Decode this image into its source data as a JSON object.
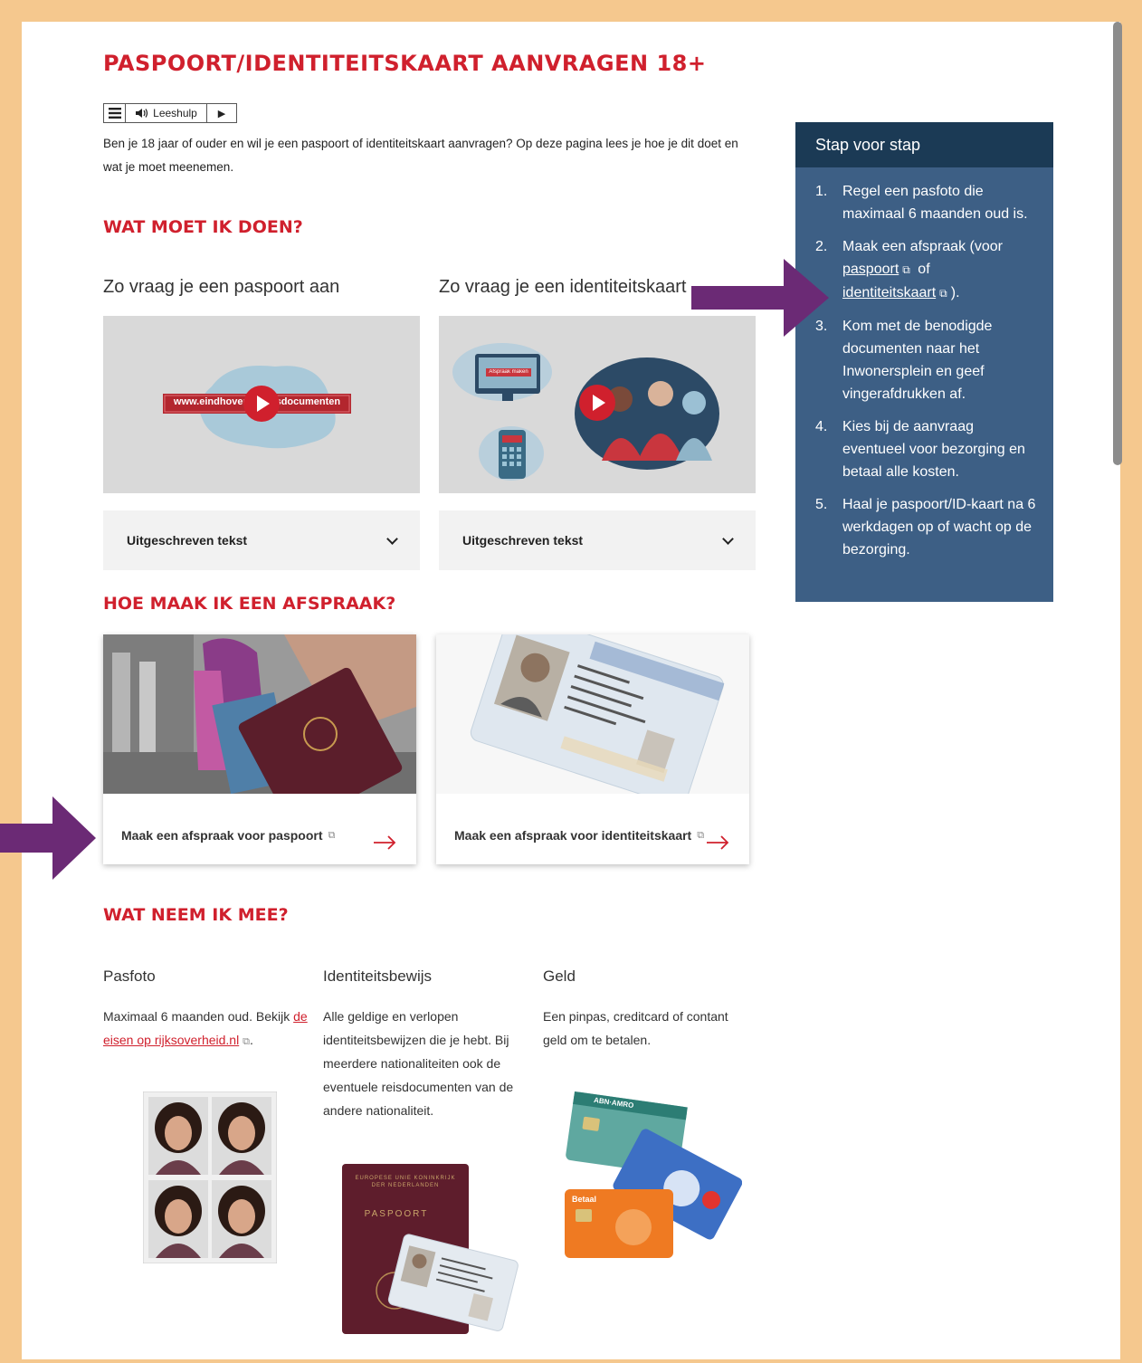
{
  "page": {
    "title": "PASPOORT/IDENTITEITSKAART AANVRAGEN 18+",
    "intro": "Ben je 18 jaar of ouder en wil je een paspoort of identiteitskaart aanvragen? Op deze pagina lees je hoe je dit doet en wat je moet meenemen."
  },
  "leeshulp": {
    "label": "Leeshulp"
  },
  "sections": {
    "wat_moet": "WAT MOET IK DOEN?",
    "afspraak": "HOE MAAK IK EEN AFSPRAAK?",
    "meenemen": "WAT NEEM IK MEE?"
  },
  "videos": [
    {
      "title": "Zo vraag je een paspoort aan",
      "banner": "www.eindhoven.nl/reisdocumenten",
      "accordion": "Uitgeschreven tekst"
    },
    {
      "title": "Zo vraag je een identiteitskaart aan",
      "screen_label": "Afspraak maken",
      "accordion": "Uitgeschreven tekst"
    }
  ],
  "cards": [
    {
      "caption": "Maak een afspraak voor paspoort"
    },
    {
      "caption": "Maak een afspraak voor identiteitskaart"
    }
  ],
  "sidebar": {
    "title": "Stap voor stap",
    "steps": [
      {
        "num": "1.",
        "text": "Regel een pasfoto die maximaal 6 maanden oud is."
      },
      {
        "num": "2.",
        "pre": "Maak een afspraak (voor",
        "link1": "paspoort",
        "mid": "of",
        "link2": "identiteitskaart",
        "post": ")."
      },
      {
        "num": "3.",
        "text": "Kom met de benodigde documenten naar het Inwonersplein en geef vingerafdrukken af."
      },
      {
        "num": "4.",
        "text": "Kies bij de aanvraag eventueel voor bezorging en betaal alle kosten."
      },
      {
        "num": "5.",
        "text": "Haal je paspoort/ID-kaart na 6 werkdagen op of wacht op de bezorging."
      }
    ]
  },
  "meenemen": [
    {
      "title": "Pasfoto",
      "pre": "Maximaal 6 maanden oud. Bekijk",
      "link": "de eisen op rijksoverheid.nl",
      "post": "."
    },
    {
      "title": "Identiteitsbewijs",
      "text": "Alle geldige en verlopen identiteitsbewijzen die je hebt. Bij meerdere nationaliteiten ook de eventuele reisdocumenten van de andere nationaliteit."
    },
    {
      "title": "Geld",
      "text": "Een pinpas, creditcard of contant geld om te betalen."
    }
  ],
  "images": {
    "passport_cover_top": "EUROPESE UNIE KONINKRIJK DER NEDERLANDEN",
    "passport_cover_word": "PASPOORT",
    "card_bank": "ABN·AMRO",
    "card_orange": "Betaal"
  },
  "colors": {
    "brand_red": "#d0202d",
    "sidebar_bg": "#3d5f85",
    "sidebar_head": "#1b3a55",
    "annotation_arrow": "#6b2a75",
    "frame": "#f5c88e"
  }
}
